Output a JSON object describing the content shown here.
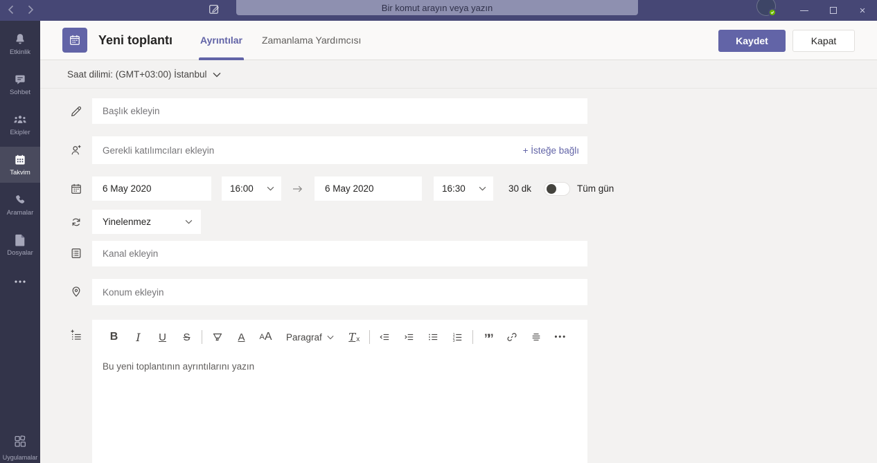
{
  "titlebar": {
    "search_placeholder": "Bir komut arayın veya yazın"
  },
  "sidebar": {
    "items": [
      {
        "label": "Etkinlik",
        "icon": "bell-icon",
        "active": false
      },
      {
        "label": "Sohbet",
        "icon": "chat-icon",
        "active": false
      },
      {
        "label": "Ekipler",
        "icon": "teams-icon",
        "active": false
      },
      {
        "label": "Takvim",
        "icon": "calendar-icon",
        "active": true
      },
      {
        "label": "Aramalar",
        "icon": "phone-icon",
        "active": false
      },
      {
        "label": "Dosyalar",
        "icon": "file-icon",
        "active": false
      }
    ],
    "apps_label": "Uygulamalar"
  },
  "header": {
    "title": "Yeni toplantı",
    "tab_details": "Ayrıntılar",
    "tab_scheduling": "Zamanlama Yardımcısı",
    "save_label": "Kaydet",
    "close_label": "Kapat"
  },
  "timezone_label": "Saat dilimi: (GMT+03:00) İstanbul",
  "form": {
    "title_placeholder": "Başlık ekleyin",
    "required_attendees_placeholder": "Gerekli katılımcıları ekleyin",
    "optional_attendees_link": "+ İsteğe bağlı",
    "start_date": "6 May 2020",
    "start_time": "16:00",
    "end_date": "6 May 2020",
    "end_time": "16:30",
    "duration_label": "30 dk",
    "all_day_label": "Tüm gün",
    "recurrence_value": "Yinelenmez",
    "channel_placeholder": "Kanal ekleyin",
    "location_placeholder": "Konum ekleyin"
  },
  "editor": {
    "placeholder": "Bu yeni toplantının ayrıntılarını yazın",
    "toolbar": {
      "bold": "B",
      "italic": "I",
      "underline": "U",
      "strikethrough": "S",
      "font_color": "A",
      "font_size_small": "A",
      "font_size_large": "A",
      "paragraph": "Paragraf",
      "clear_format_t": "T",
      "clear_format_x": "x",
      "quote": "””",
      "more": "•••"
    }
  },
  "colors": {
    "accent": "#6264A7",
    "topbar": "#464775",
    "sidebar": "#33344A",
    "presence_available": "#6BB700",
    "background": "#F3F2F1"
  }
}
